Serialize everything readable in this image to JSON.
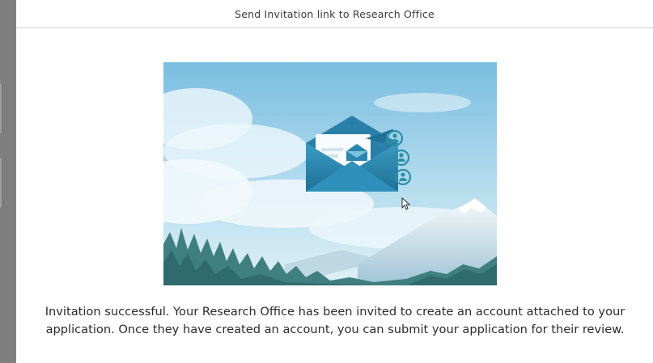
{
  "dialog": {
    "title": "Send Invitation link to Research Office",
    "message": "Invitation successful. Your Research Office has been invited to create an account attached to your application. Once they have created an account, you can submit your application for their review."
  },
  "illustration": {
    "icon": "envelope-with-user-icons",
    "sky_color": "#8fc9e6",
    "envelope_color": "#2b8ab3",
    "user_icon_color": "#2e8ea6"
  }
}
